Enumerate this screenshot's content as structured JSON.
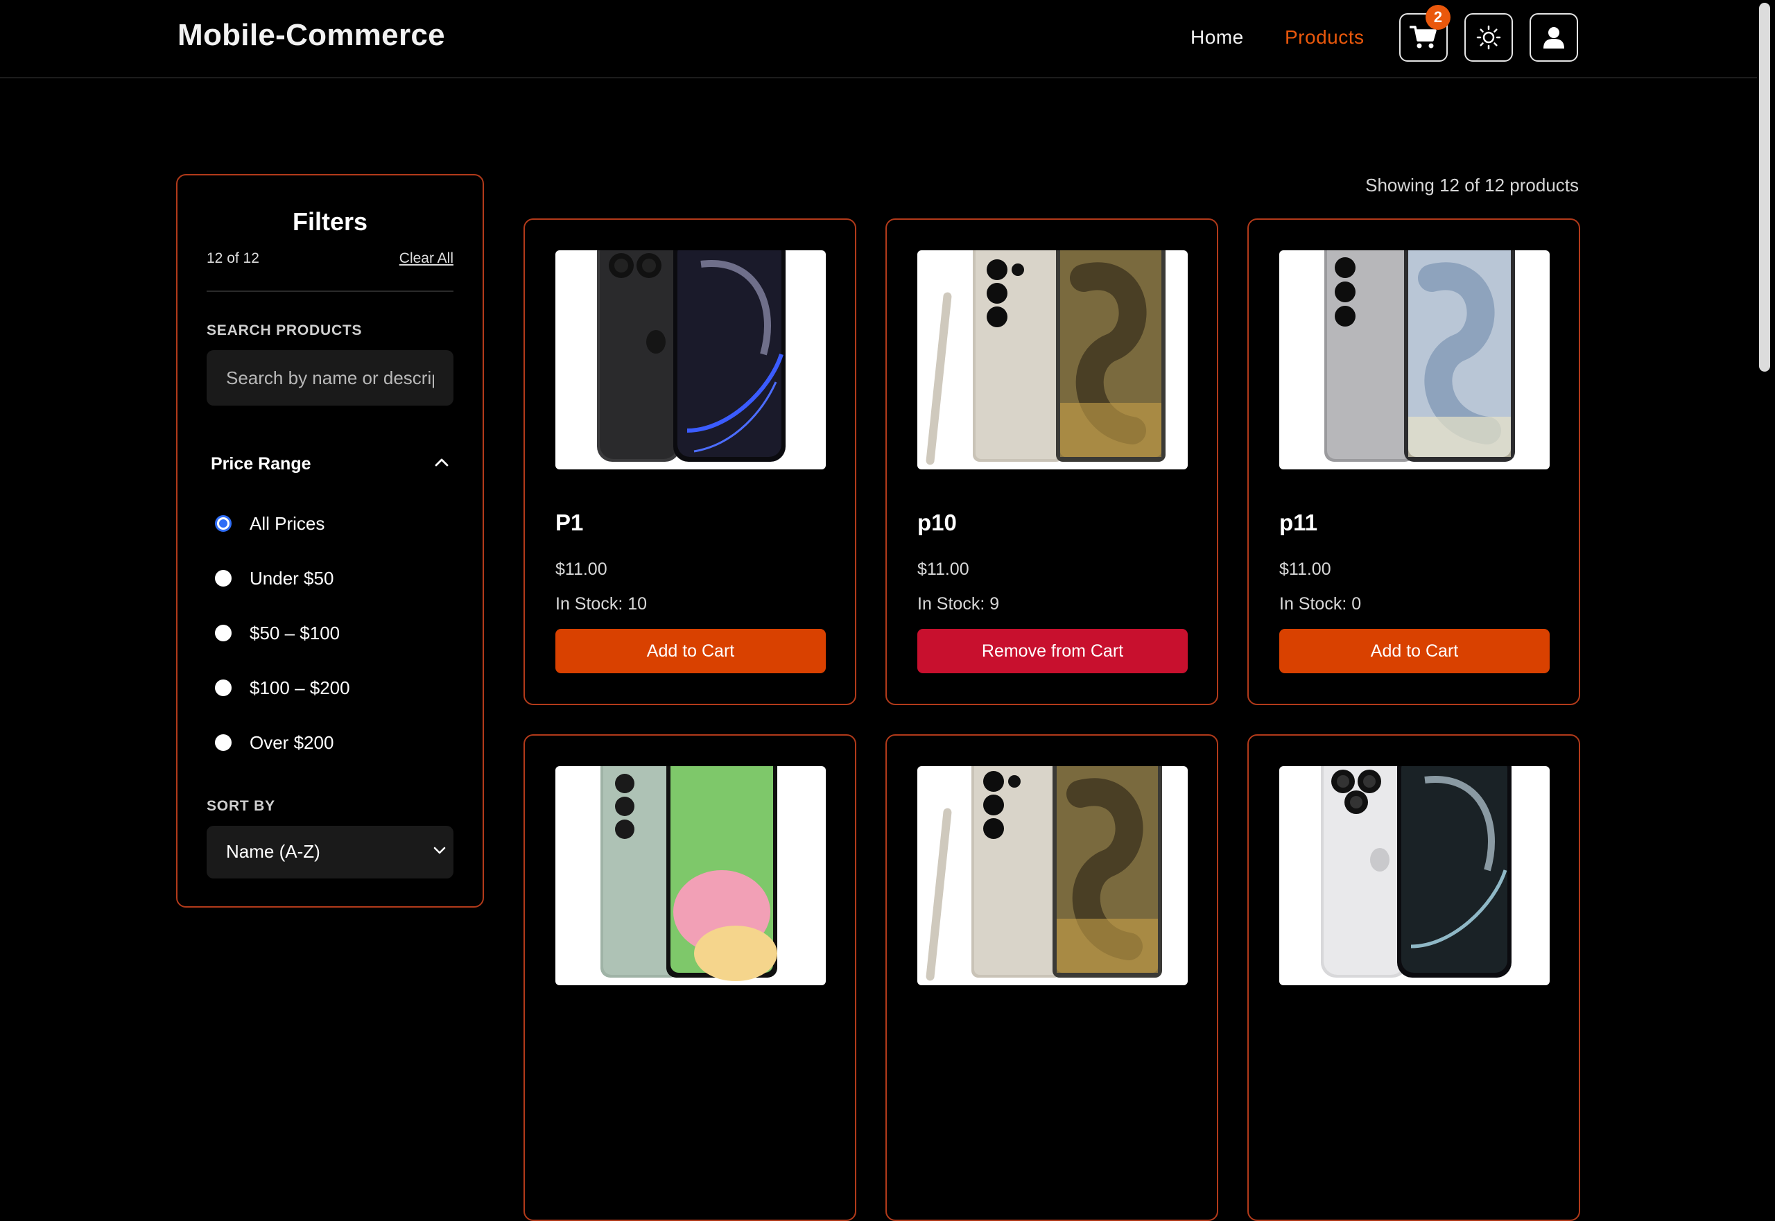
{
  "header": {
    "brand": "Mobile-Commerce",
    "nav": {
      "home": "Home",
      "products": "Products"
    },
    "cart_count": "2",
    "accent_color": "#ea580c"
  },
  "sidebar": {
    "title": "Filters",
    "count": "12 of 12",
    "clear_all": "Clear All",
    "search_label": "SEARCH PRODUCTS",
    "search_placeholder": "Search by name or description...",
    "search_value": "",
    "price_title": "Price Range",
    "price_options": [
      {
        "label": "All Prices",
        "checked": true
      },
      {
        "label": "Under $50",
        "checked": false
      },
      {
        "label": "$50 – $100",
        "checked": false
      },
      {
        "label": "$100 – $200",
        "checked": false
      },
      {
        "label": "Over $200",
        "checked": false
      }
    ],
    "sort_label": "SORT BY",
    "sort_value": "Name (A-Z)"
  },
  "products": {
    "showing": "Showing 12 of 12 products",
    "items": [
      {
        "name": "P1",
        "price": "$11.00",
        "stock": "In Stock: 10",
        "action": "Add to Cart",
        "image": "iphone-dark-titanium"
      },
      {
        "name": "p10",
        "price": "$11.00",
        "stock": "In Stock: 9",
        "action": "Remove from Cart",
        "image": "galaxy-ultra-titanium"
      },
      {
        "name": "p11",
        "price": "$11.00",
        "stock": "In Stock: 0",
        "action": "Add to Cart",
        "image": "galaxy-silver"
      },
      {
        "name": "",
        "price": "",
        "stock": "",
        "action": "",
        "image": "galaxy-mint"
      },
      {
        "name": "",
        "price": "",
        "stock": "",
        "action": "",
        "image": "galaxy-ultra-titanium"
      },
      {
        "name": "",
        "price": "",
        "stock": "",
        "action": "",
        "image": "iphone-white-titanium"
      }
    ]
  }
}
